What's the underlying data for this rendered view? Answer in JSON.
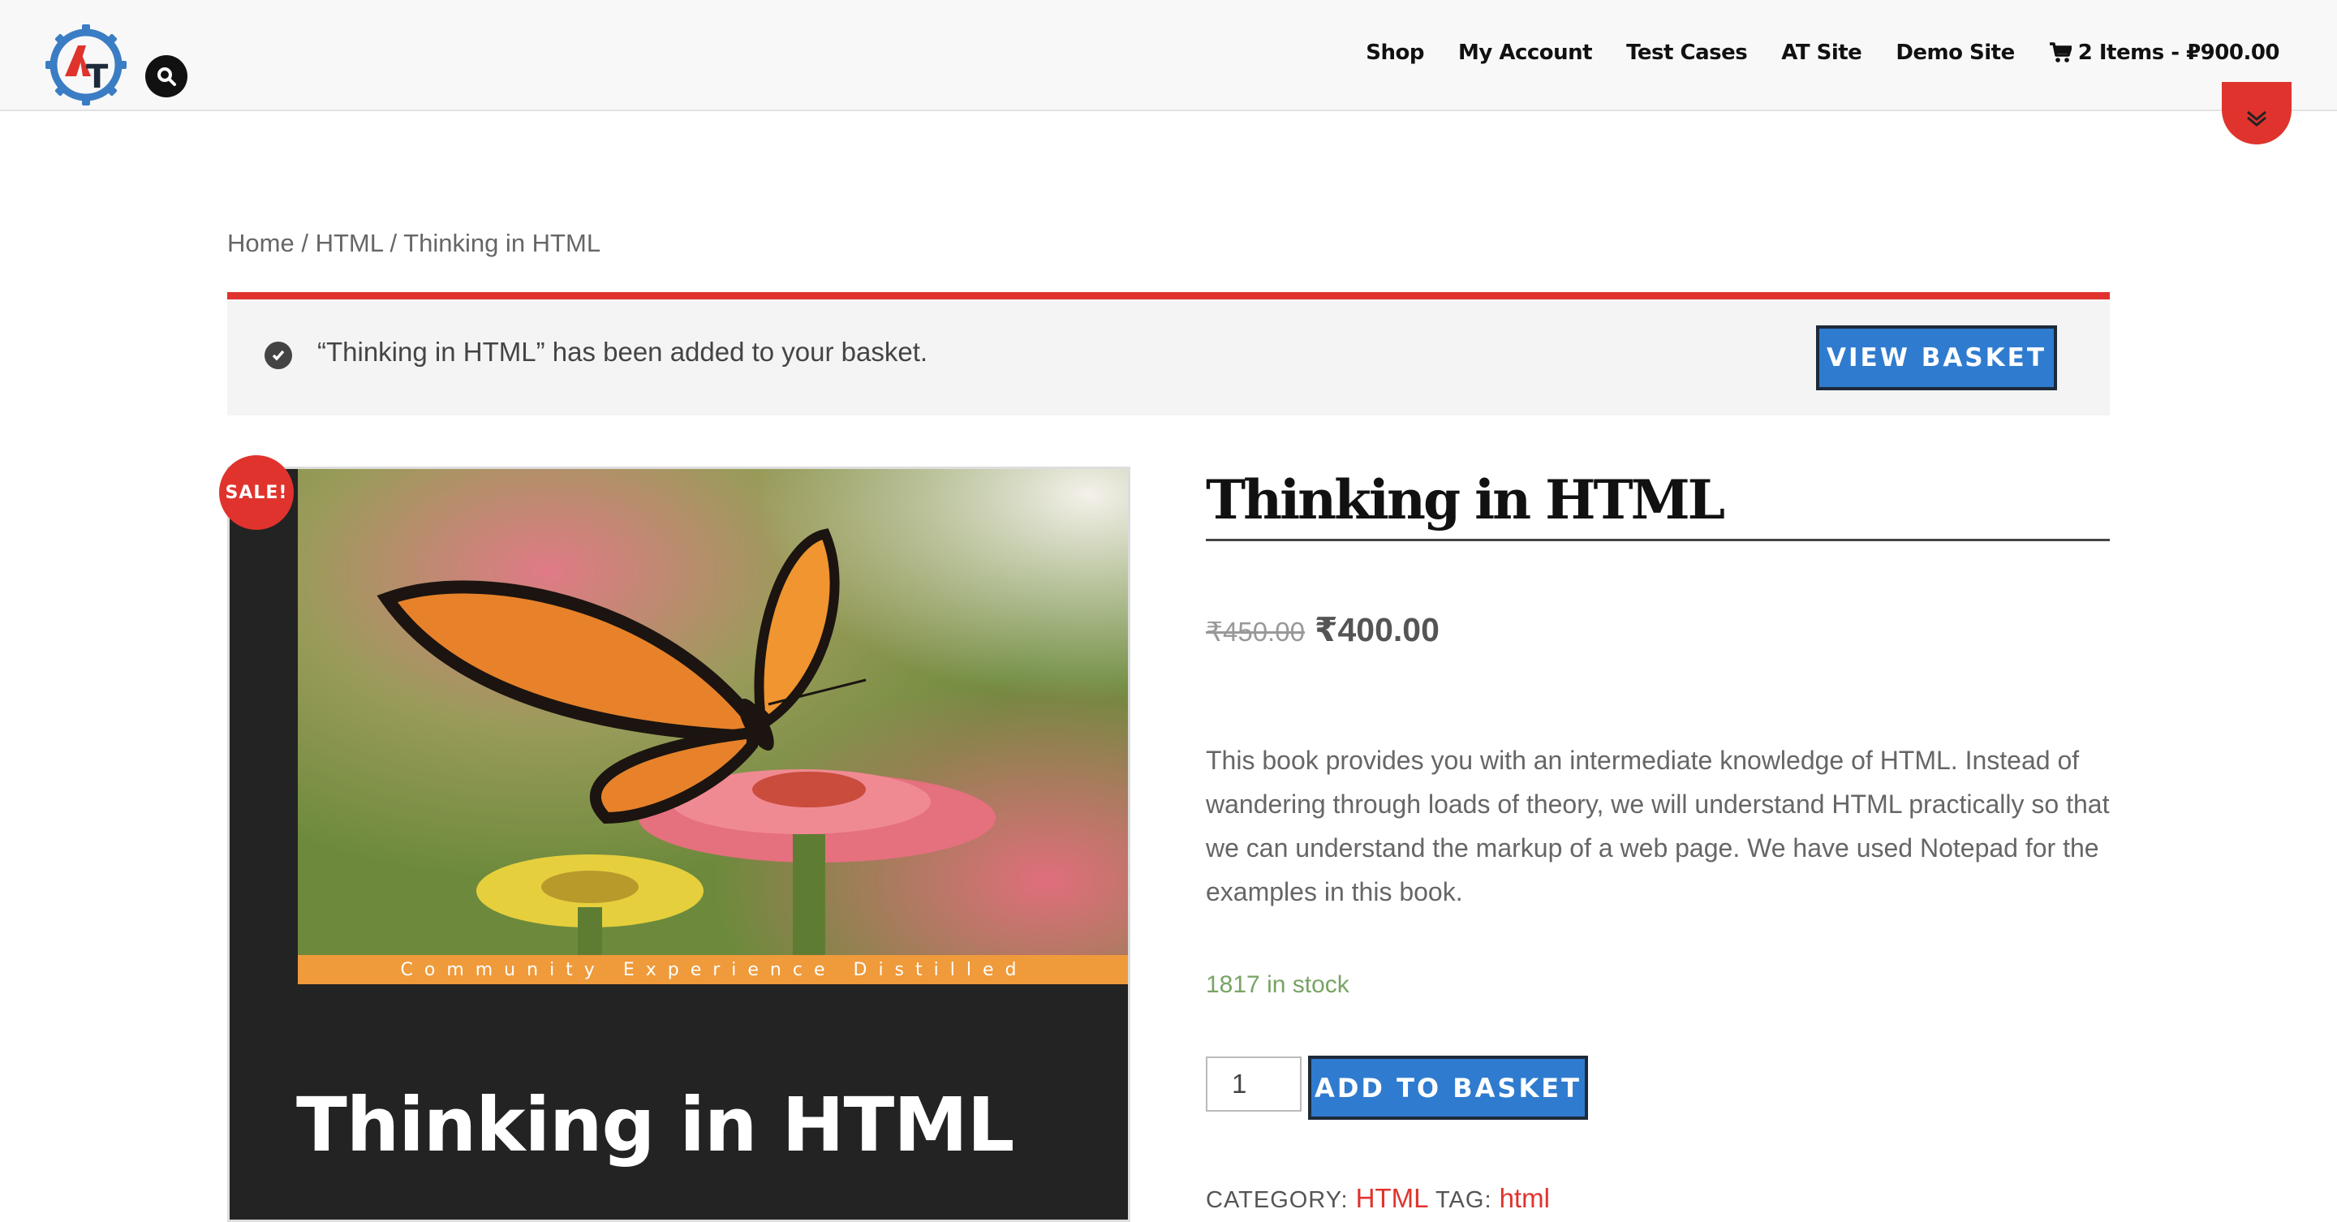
{
  "header": {
    "nav": [
      {
        "label": "Shop"
      },
      {
        "label": "My Account"
      },
      {
        "label": "Test Cases"
      },
      {
        "label": "AT Site"
      },
      {
        "label": "Demo Site"
      }
    ],
    "cart_label": "2 Items - ₽900.00"
  },
  "breadcrumb": {
    "home": "Home",
    "category": "HTML",
    "current": "Thinking in HTML",
    "separator": "/"
  },
  "notice": {
    "message": "“Thinking in HTML” has been added to your basket.",
    "button": "VIEW BASKET"
  },
  "product": {
    "sale_badge": "SALE!",
    "cover_strip": "Community Experience Distilled",
    "cover_title": "Thinking in HTML",
    "title": "Thinking in HTML",
    "price_old": "₹450.00",
    "price_new": "₹400.00",
    "description": "This book provides you with an intermediate knowledge of HTML. Instead of wandering through loads of theory, we will understand HTML practically so that we can understand the markup of a web page. We have used Notepad for the examples in this book.",
    "stock": "1817 in stock",
    "quantity": "1",
    "add_button": "ADD TO BASKET",
    "category_label": "CATEGORY:",
    "category": "HTML",
    "tag_label": "TAG:",
    "tag": "html"
  },
  "colors": {
    "accent_red": "#e0332d",
    "button_blue": "#2f7bcf",
    "stock_green": "#77a464"
  }
}
